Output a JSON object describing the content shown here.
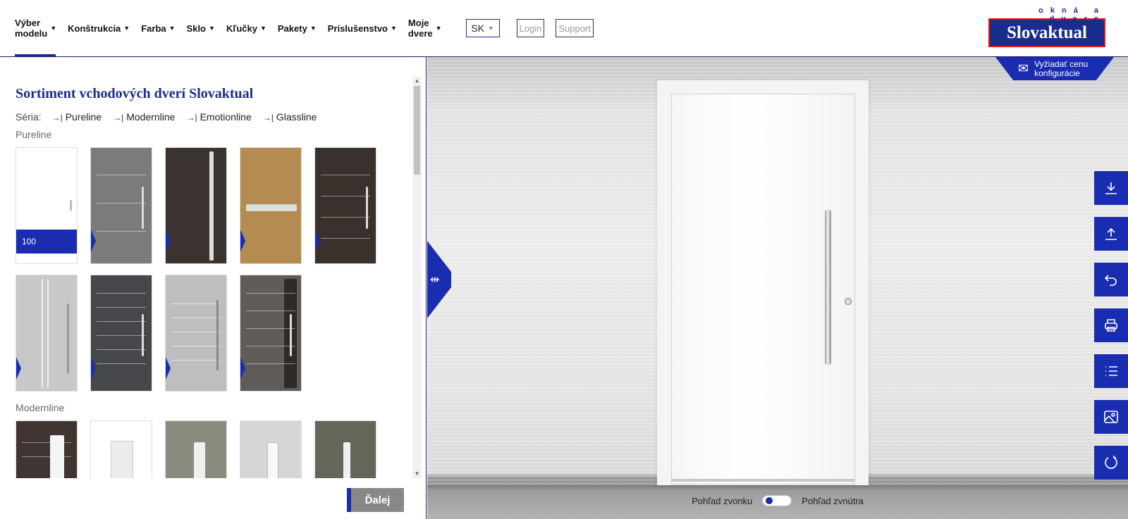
{
  "nav": {
    "items": [
      {
        "label": "Výber modelu",
        "line1": "Výber",
        "line2": "modelu"
      },
      {
        "label": "Konštrukcia"
      },
      {
        "label": "Farba"
      },
      {
        "label": "Sklo"
      },
      {
        "label": "Kľučky"
      },
      {
        "label": "Pakety"
      },
      {
        "label": "Príslušenstvo"
      },
      {
        "label": "Moje dvere",
        "line1": "Moje",
        "line2": "dvere"
      }
    ],
    "language": "SK",
    "login_label": "Login",
    "support_label": "Support"
  },
  "logo": {
    "tagline": "okná a dvere",
    "brand": "Slovaktual"
  },
  "catalog": {
    "title": "Sortiment vchodových dverí Slovaktual",
    "series_label": "Séria:",
    "series_links": [
      "Pureline",
      "Modernline",
      "Emotionline",
      "Glassline"
    ],
    "groups": [
      {
        "name": "Pureline",
        "models": [
          {
            "color": "#ffffff",
            "badge": "100"
          },
          {
            "color": "#7b7b7b"
          },
          {
            "color": "#3b3330"
          },
          {
            "color": "#b48b51"
          },
          {
            "color": "#3a302c"
          },
          {
            "color": "#c8c8c8"
          },
          {
            "color": "#45474a"
          },
          {
            "color": "#bcbec0"
          },
          {
            "color": "#5f5c59"
          }
        ]
      },
      {
        "name": "Modernline",
        "models": [
          {
            "color": "#403530"
          },
          {
            "color": "#ffffff"
          },
          {
            "color": "#8c8b80"
          },
          {
            "color": "#d6d6d6"
          },
          {
            "color": "#626759"
          }
        ]
      }
    ],
    "next_label": "Ďalej"
  },
  "viewer": {
    "quote_label_line1": "Vyžiadať cenu",
    "quote_label_line2": "konfigurácie",
    "view_outside_label": "Pohľad zvonku",
    "view_inside_label": "Pohľad zvnútra",
    "view_mode": "outside",
    "tools": [
      "download-icon",
      "upload-icon",
      "undo-icon",
      "print-icon",
      "list-icon",
      "image-icon",
      "reset-icon"
    ],
    "accent_color": "#1a2cb0"
  }
}
